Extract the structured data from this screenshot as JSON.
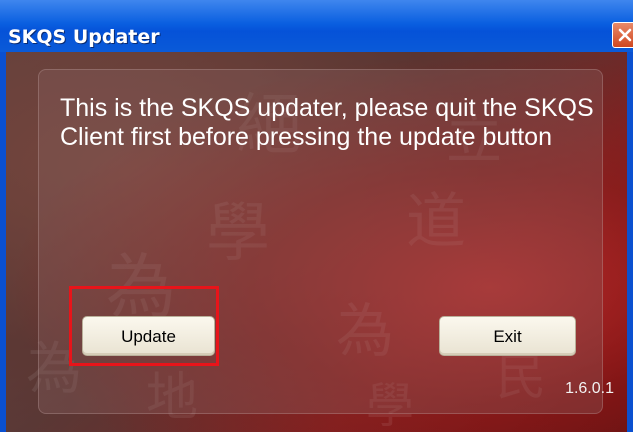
{
  "window": {
    "title": "SKQS Updater",
    "close_icon": "close-icon"
  },
  "content": {
    "message": "This is the SKQS updater, please quit the SKQS Client first before pressing the update button",
    "update_label": "Update",
    "exit_label": "Exit",
    "version": "1.6.0.1"
  },
  "colors": {
    "titlebar": "#0552d8",
    "highlight": "#e8141a",
    "background": "#7a2222"
  }
}
